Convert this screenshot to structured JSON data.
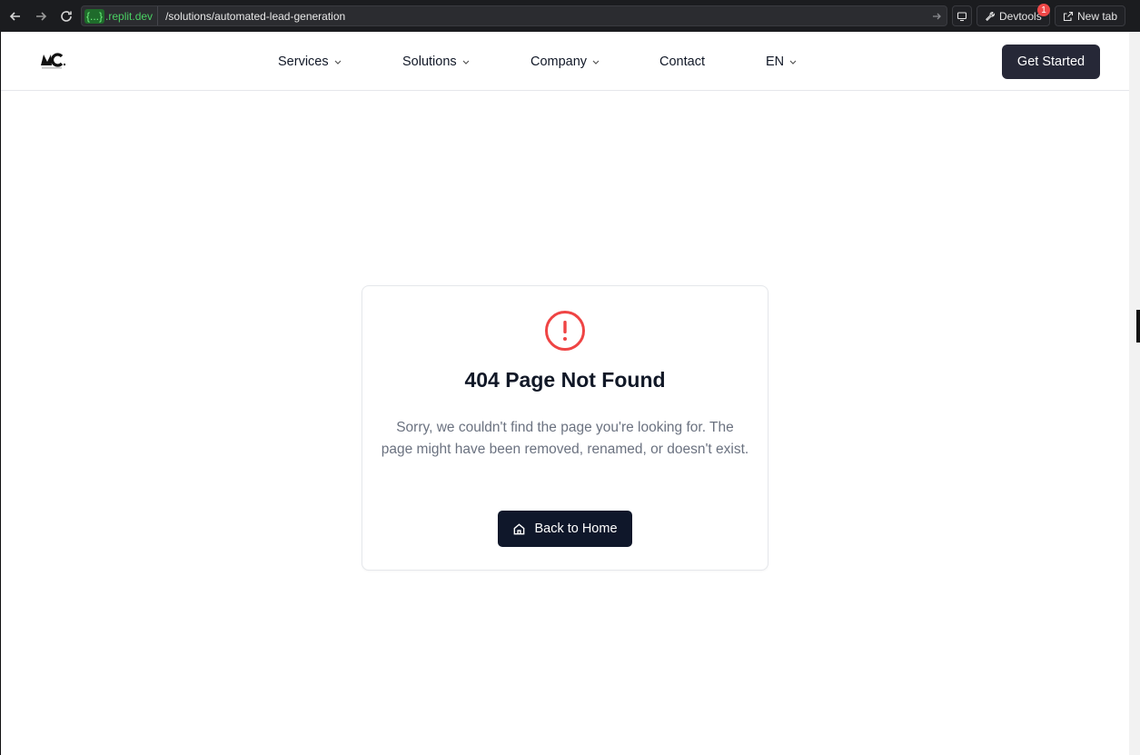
{
  "browser": {
    "url_domain_braces": "{...}",
    "url_domain": ".replit.dev",
    "url_path": "/solutions/automated-lead-generation",
    "devtools_label": "Devtools",
    "devtools_badge": "1",
    "new_tab_label": "New tab"
  },
  "header": {
    "nav": {
      "services": "Services",
      "solutions": "Solutions",
      "company": "Company",
      "contact": "Contact",
      "language": "EN"
    },
    "cta_label": "Get Started"
  },
  "error": {
    "title": "404 Page Not Found",
    "message": "Sorry, we couldn't find the page you're looking for. The page might have been removed, renamed, or doesn't exist.",
    "button_label": "Back to Home",
    "accent_color": "#ef4444"
  }
}
